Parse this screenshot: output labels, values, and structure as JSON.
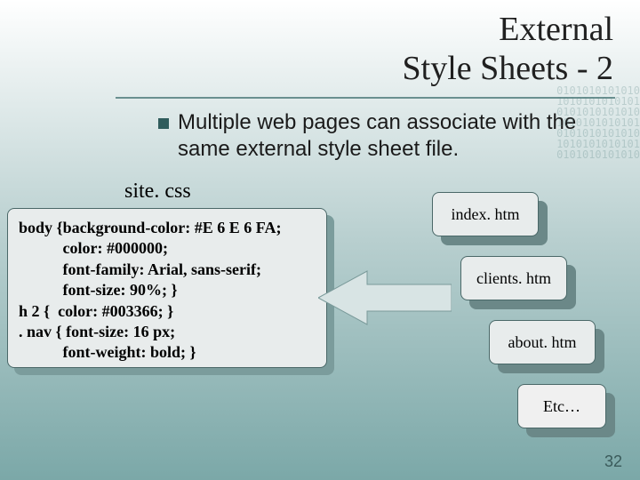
{
  "title_line1": "External",
  "title_line2": "Style Sheets - 2",
  "bullet_text": "Multiple web pages can associate with the same external style sheet file.",
  "css_filename": "site. css",
  "code_lines": "body {background-color: #E 6 E 6 FA;\n           color: #000000;\n           font-family: Arial, sans-serif;\n           font-size: 90%; }\nh 2 {  color: #003366; }\n. nav { font-size: 16 px;\n           font-weight: bold; }",
  "files": {
    "index": "index. htm",
    "clients": "clients. htm",
    "about": "about. htm",
    "etc": "Etc…"
  },
  "slide_number": "32",
  "colors": {
    "accent_dark": "#305c5c",
    "box_bg": "#e8ecec"
  }
}
